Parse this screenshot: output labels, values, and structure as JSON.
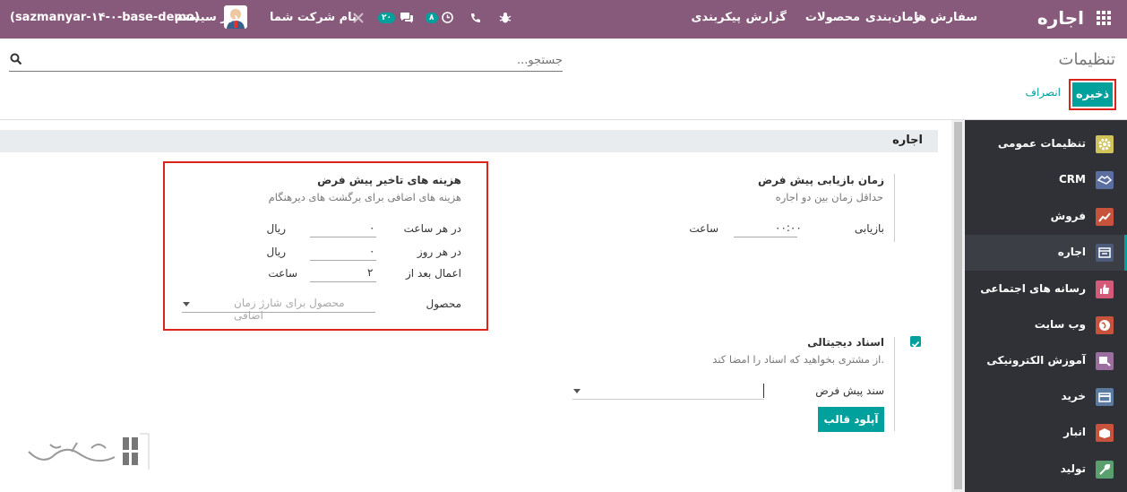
{
  "topbar": {
    "app_title": "اجاره",
    "menu": [
      "سفارش ها",
      "زمان‌بندی",
      "محصولات",
      "گزارش",
      "پیکربندی"
    ],
    "company": "نام شرکت شما",
    "messages_badge": "۲۰",
    "activities_badge": "۸",
    "user_name": "مدیر سیستم",
    "database": "(sazmanyar-۱۴-۰-base-demo)"
  },
  "page": {
    "title": "تنظیمات"
  },
  "search": {
    "placeholder": "جستجو..."
  },
  "actions": {
    "save": "ذخیره",
    "discard": "انصراف"
  },
  "sidebar": {
    "items": [
      {
        "label": "تنظیمات عمومی",
        "icon": "gear-icon",
        "color": "#cfc35a"
      },
      {
        "label": "CRM",
        "icon": "handshake-icon",
        "color": "#5a6ea0"
      },
      {
        "label": "فروش",
        "icon": "chart-icon",
        "color": "#c8533c"
      },
      {
        "label": "اجاره",
        "icon": "rental-icon",
        "color": "#4d5b7a"
      },
      {
        "label": "رسانه های اجتماعی",
        "icon": "thumbs-up-icon",
        "color": "#d45a7a"
      },
      {
        "label": "وب سایت",
        "icon": "globe-icon",
        "color": "#c8533c"
      },
      {
        "label": "آموزش الکترونیکی",
        "icon": "elearning-icon",
        "color": "#9b6ea0"
      },
      {
        "label": "خرید",
        "icon": "card-icon",
        "color": "#5a7aa0"
      },
      {
        "label": "انبار",
        "icon": "box-icon",
        "color": "#c8533c"
      },
      {
        "label": "تولید",
        "icon": "wrench-icon",
        "color": "#5aa06e"
      }
    ]
  },
  "section": {
    "title": "اجاره"
  },
  "padding_time": {
    "title": "زمان بازیابی پیش فرض",
    "desc": "حداقل زمان بین دو اجاره",
    "field_label": "بازیابی",
    "value": "۰۰:۰۰",
    "unit": "ساعت"
  },
  "delay_costs": {
    "title": "هزینه های تاخیر پیش فرض",
    "desc": "هزینه های اضافی برای برگشت های دیرهنگام",
    "per_hour_label": "در هر ساعت",
    "per_hour_value": "۰",
    "per_hour_unit": "ریال",
    "per_day_label": "در هر روز",
    "per_day_value": "۰",
    "per_day_unit": "ریال",
    "apply_after_label": "اعمال بعد از",
    "apply_after_value": "۲",
    "apply_after_unit": "ساعت",
    "product_label": "محصول",
    "product_placeholder": "محصول برای شارژ زمان اضافی"
  },
  "digital_docs": {
    "title": "اسناد دیجیتالی",
    "desc": "از مشتری بخواهید که اسناد را امضا کند.",
    "checked": true,
    "default_doc_label": "سند پیش فرض",
    "upload_button": "آپلود قالب"
  }
}
